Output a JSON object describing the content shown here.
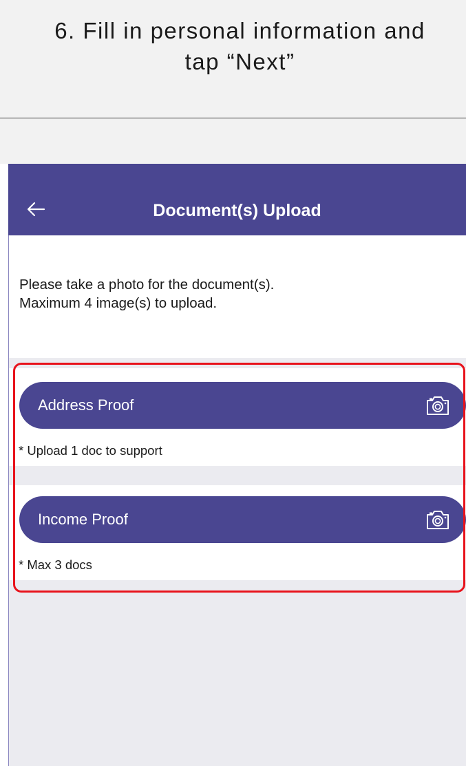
{
  "instruction": {
    "line1": "6. Fill in personal information and",
    "line2": "tap “Next”"
  },
  "app": {
    "title": "Document(s) Upload",
    "back_icon": "arrow-left-icon",
    "brand_color": "#4a4691"
  },
  "intro": {
    "line1": "Please take a photo for the document(s).",
    "line2": "Maximum 4 image(s) to upload."
  },
  "sections": [
    {
      "label": "Address Proof",
      "note": "* Upload 1 doc to support",
      "icon": "camera-icon"
    },
    {
      "label": "Income Proof",
      "note": "* Max 3 docs",
      "icon": "camera-icon"
    }
  ],
  "highlight_color": "#e8121b"
}
